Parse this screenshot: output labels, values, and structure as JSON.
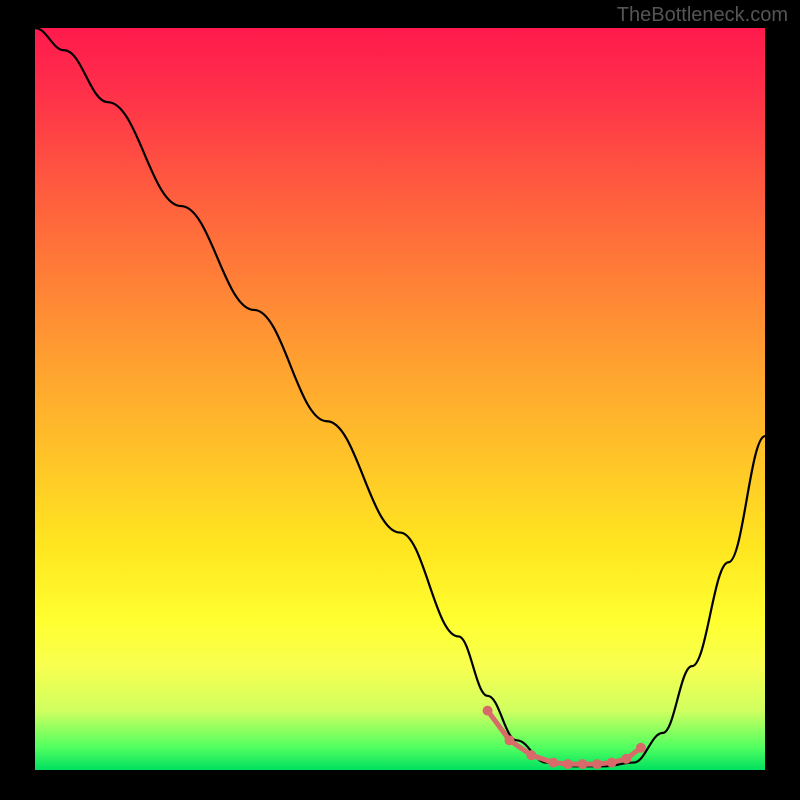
{
  "watermark": "TheBottleneck.com",
  "chart_data": {
    "type": "line",
    "title": "",
    "xlabel": "",
    "ylabel": "",
    "xlim": [
      0,
      100
    ],
    "ylim": [
      0,
      100
    ],
    "curve": {
      "name": "bottleneck-curve",
      "x": [
        0,
        4,
        10,
        20,
        30,
        40,
        50,
        58,
        62,
        66,
        70,
        74,
        78,
        82,
        86,
        90,
        95,
        100
      ],
      "y": [
        100,
        97,
        90,
        76,
        62,
        47,
        32,
        18,
        10,
        4,
        1,
        0.5,
        0.5,
        1,
        5,
        14,
        28,
        45
      ]
    },
    "highlighted_points": {
      "name": "optimal-range",
      "color": "#d86a6a",
      "x": [
        62,
        65,
        68,
        71,
        73,
        75,
        77,
        79,
        81,
        83
      ],
      "y": [
        8,
        4,
        2,
        1,
        0.8,
        0.8,
        0.8,
        1,
        1.5,
        3
      ]
    },
    "gradient_stops": [
      {
        "pos": 0,
        "color": "#ff1a4d"
      },
      {
        "pos": 50,
        "color": "#ffc020"
      },
      {
        "pos": 85,
        "color": "#ffff40"
      },
      {
        "pos": 100,
        "color": "#00e060"
      }
    ]
  }
}
